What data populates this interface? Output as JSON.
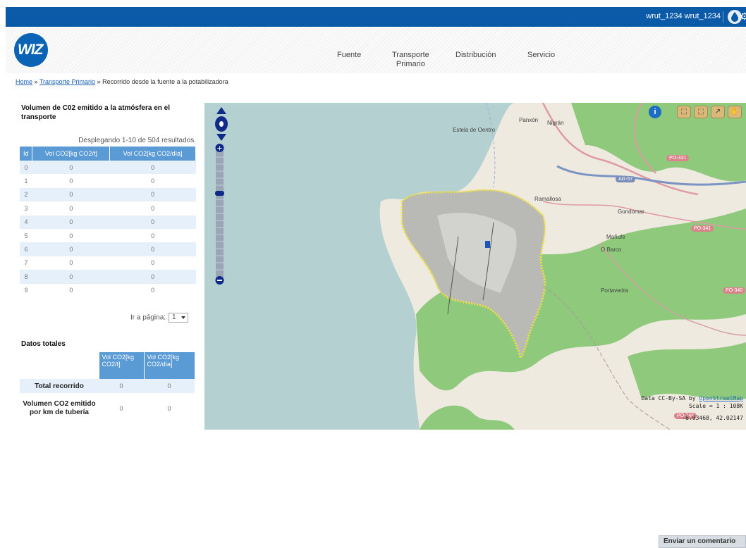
{
  "topbar": {
    "username": "wrut_1234 wrut_1234",
    "bg_color": "#0a5aa8"
  },
  "logo": {
    "text": "WIZ"
  },
  "nav": [
    {
      "label": "Fuente"
    },
    {
      "label": "Transporte\nPrimario"
    },
    {
      "label": "Distribución"
    },
    {
      "label": "Servicio"
    }
  ],
  "breadcrumb": {
    "home": "Home",
    "sep": " » ",
    "transporte": "Transporte Primario",
    "current": "Recorrido desde la fuente a la potabilizadora"
  },
  "emissions": {
    "title": "Volumen de C02 emitido a la atmósfera en el transporte",
    "results_text": "Desplegando 1-10 de 504 resultados.",
    "columns": [
      "Id",
      "Vol CO2[kg CO2/t]",
      "Vol CO2[kg CO2/día]"
    ],
    "rows": [
      [
        "0",
        "0",
        "0"
      ],
      [
        "1",
        "0",
        "0"
      ],
      [
        "2",
        "0",
        "0"
      ],
      [
        "3",
        "0",
        "0"
      ],
      [
        "4",
        "0",
        "0"
      ],
      [
        "5",
        "0",
        "0"
      ],
      [
        "6",
        "0",
        "0"
      ],
      [
        "7",
        "0",
        "0"
      ],
      [
        "8",
        "0",
        "0"
      ],
      [
        "9",
        "0",
        "0"
      ]
    ],
    "pager_label": "Ir a página:",
    "pager_value": "1"
  },
  "totals": {
    "title": "Datos totales",
    "columns": [
      "Vol CO2[kg CO2/t]",
      "Vol CO2[kg CO2/día]"
    ],
    "rows": [
      {
        "label": "Total recorrido",
        "v1": "0",
        "v2": "0"
      },
      {
        "label": "Volumen CO2 emitido por km de tubería",
        "v1": "0",
        "v2": "0"
      }
    ]
  },
  "map": {
    "places": {
      "estela": "Estela de Oentro",
      "panxon": "Panxón",
      "nigran": "Nigrán",
      "ramallosa": "Ramallosa",
      "gondomar": "Gondomar",
      "mañufe": "Mañufe",
      "obarco": "O Barco",
      "portavedra": "Portavedra"
    },
    "roads": {
      "po331": "PO-331",
      "ag57": "AG-57",
      "po341": "PO-341",
      "po340": "PO-340",
      "po344": "PO-344"
    },
    "attribution_prefix": "Data CC-By-SA by ",
    "attribution_link": "OpenStreetMap",
    "scale": "Scale = 1 : 108K",
    "coords": "-8.93468, 42.02147",
    "land_color": "#eeeae0",
    "forest_color": "#8ec97c",
    "water_color": "#b5d0d0"
  },
  "feedback": {
    "label": "Enviar un comentario"
  }
}
